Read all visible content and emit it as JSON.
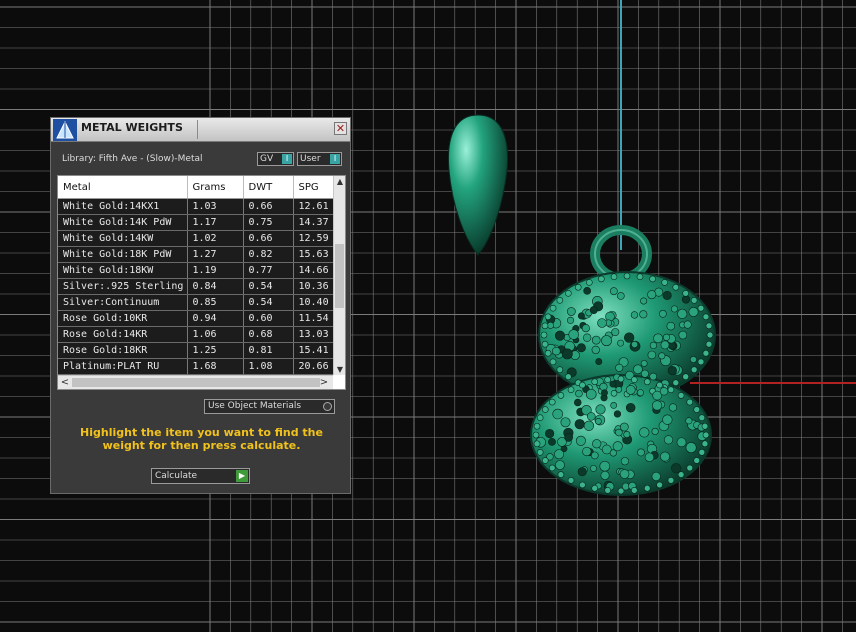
{
  "panel": {
    "title": "METAL WEIGHTS",
    "close_glyph": "✕",
    "library_label": "Library: Fifth Ave - (Slow)-Metal",
    "toggle_gv": "GV",
    "toggle_user": "User",
    "toggle_knob": "I",
    "table": {
      "headers": [
        "Metal",
        "Grams",
        "DWT",
        "SPG"
      ],
      "rows": [
        [
          "White Gold:14KX1",
          "1.03",
          "0.66",
          "12.61"
        ],
        [
          "White Gold:14K PdW",
          "1.17",
          "0.75",
          "14.37"
        ],
        [
          "White Gold:14KW",
          "1.02",
          "0.66",
          "12.59"
        ],
        [
          "White Gold:18K PdW",
          "1.27",
          "0.82",
          "15.63"
        ],
        [
          "White Gold:18KW",
          "1.19",
          "0.77",
          "14.66"
        ],
        [
          "Silver:.925 Sterling",
          "0.84",
          "0.54",
          "10.36"
        ],
        [
          "Silver:Continuum",
          "0.85",
          "0.54",
          "10.40"
        ],
        [
          "Rose Gold:10KR",
          "0.94",
          "0.60",
          "11.54"
        ],
        [
          "Rose Gold:14KR",
          "1.06",
          "0.68",
          "13.03"
        ],
        [
          "Rose Gold:18KR",
          "1.25",
          "0.81",
          "15.41"
        ],
        [
          "Platinum:PLAT RU",
          "1.68",
          "1.08",
          "20.66"
        ]
      ]
    },
    "use_object_materials": "Use Object Materials",
    "instructions": "Highlight the item you want to find the weight for then press calculate.",
    "calculate_label": "Calculate",
    "calculate_glyph": "▶"
  },
  "scroll_glyphs": {
    "up": "▲",
    "down": "▼",
    "left": "<",
    "right": ">"
  },
  "icons": {
    "logo": "metal-weights-logo-icon",
    "close": "close-icon",
    "calculate": "play-icon"
  },
  "colors": {
    "viewport_bg": "#0c0c0c",
    "grid": "#7a7a7a",
    "axis_y": "#3aa6b6",
    "axis_x": "#b22222",
    "model": "#1f8a6a",
    "panel_bg": "#3a3a3a",
    "instruction_text": "#f2c21c"
  }
}
